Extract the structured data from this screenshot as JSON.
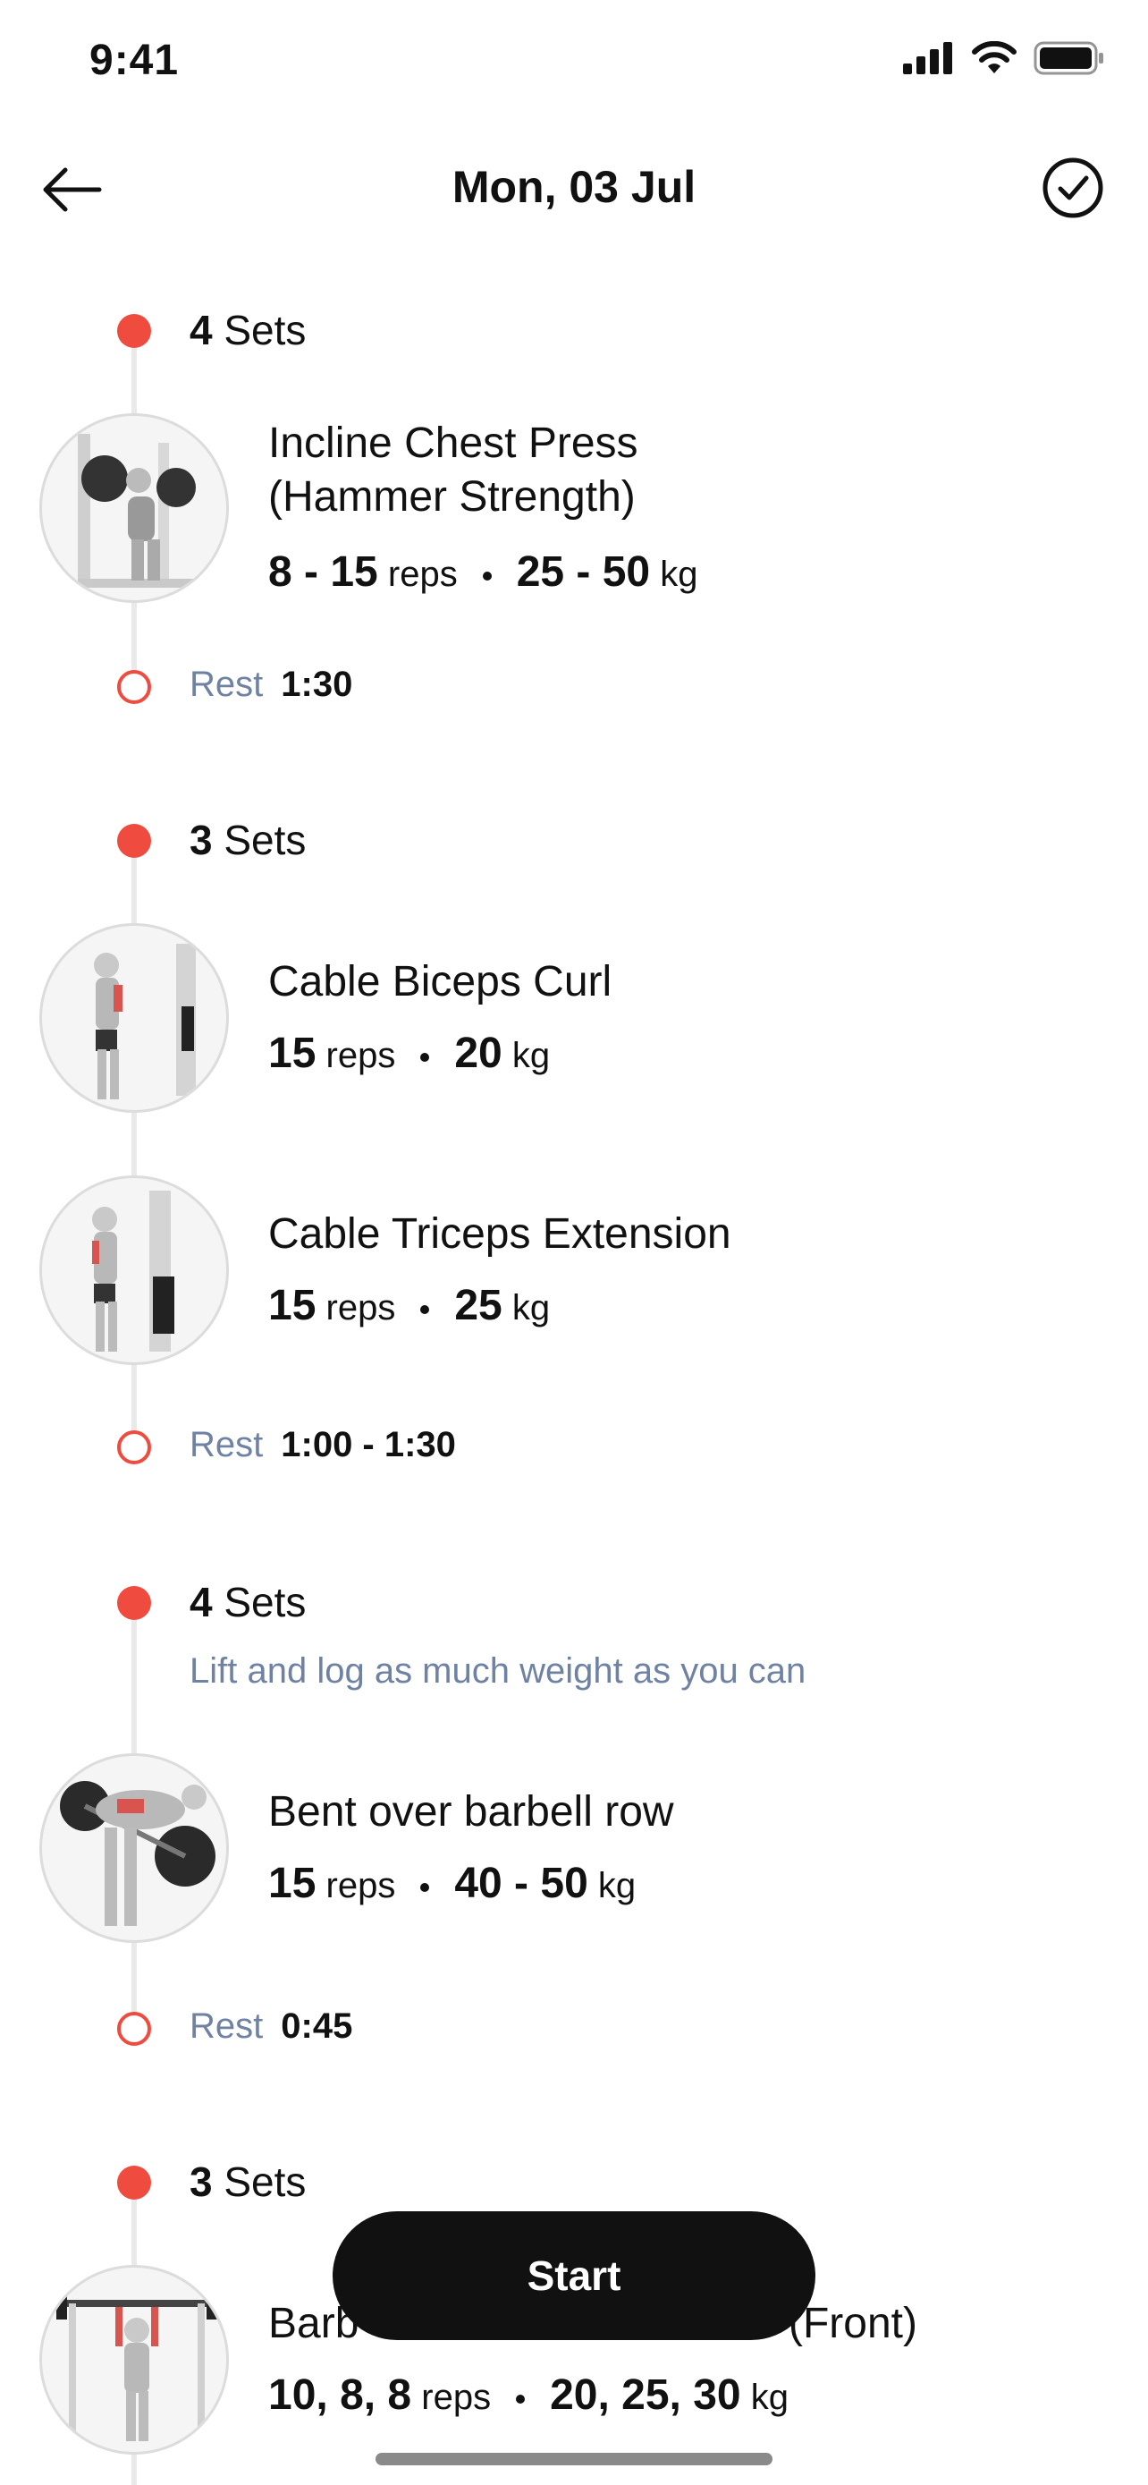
{
  "status": {
    "time": "9:41"
  },
  "header": {
    "title": "Mon, 03 Jul"
  },
  "blocks": [
    {
      "sets_count": "4",
      "sets_word": "Sets",
      "exercises": [
        {
          "name": "Incline Chest Press (Hammer Strength)",
          "reps": "8 - 15",
          "reps_unit": "reps",
          "weight": "25 - 50",
          "weight_unit": "kg"
        }
      ],
      "rest_label": "Rest",
      "rest_value": "1:30"
    },
    {
      "sets_count": "3",
      "sets_word": "Sets",
      "exercises": [
        {
          "name": "Cable Biceps Curl",
          "reps": "15",
          "reps_unit": "reps",
          "weight": "20",
          "weight_unit": "kg"
        },
        {
          "name": "Cable Triceps Extension",
          "reps": "15",
          "reps_unit": "reps",
          "weight": "25",
          "weight_unit": "kg"
        }
      ],
      "rest_label": "Rest",
      "rest_value": "1:00 - 1:30"
    },
    {
      "sets_count": "4",
      "sets_word": "Sets",
      "note": "Lift and log as much weight as you can",
      "exercises": [
        {
          "name": "Bent over barbell row",
          "reps": "15",
          "reps_unit": "reps",
          "weight": "40 - 50",
          "weight_unit": "kg"
        }
      ],
      "rest_label": "Rest",
      "rest_value": "0:45"
    },
    {
      "sets_count": "3",
      "sets_word": "Sets",
      "exercises": [
        {
          "name_left": "Barb",
          "name_right": "(Front)",
          "reps": "10, 8, 8",
          "reps_unit": "reps",
          "weight": "20, 25, 30",
          "weight_unit": "kg"
        }
      ]
    }
  ],
  "actions": {
    "start_label": "Start"
  },
  "colors": {
    "accent": "#ef4b3f",
    "muted": "#6f82a4",
    "button": "#111111"
  }
}
